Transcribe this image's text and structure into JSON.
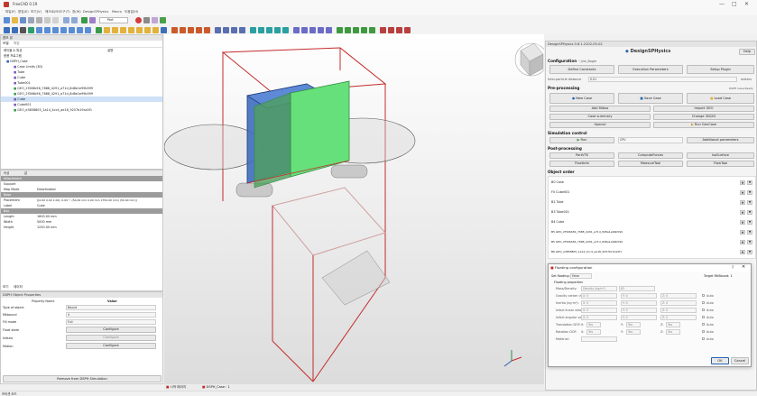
{
  "window": {
    "title": "FreeCAD 0.19",
    "controls": [
      "—",
      "□",
      "✕"
    ]
  },
  "menu": [
    "파일(F)",
    "편집(E)",
    "보기(V)",
    "매크로(M)",
    "도구(T)",
    "창(W)",
    "DesignSPHysics",
    "Macro",
    "도움말(H)"
  ],
  "toolbar": {
    "workbench": "Part"
  },
  "combo": {
    "header": "콤보 뷰",
    "tabs": [
      "모델",
      "작업"
    ],
    "col_labels": "레이블 & 특성",
    "col_value": "설명",
    "doc_label": "응용 프로그램",
    "tree": [
      "DSPH_Case",
      "Case Limits (3D)",
      "Tube",
      "Cube",
      "Tube001",
      "GEO_2f306b56_7688_4291_a71d_8d8e1e99b599",
      "GEO_2f306b56_7688_4291_a71d_8d8e1e99b599",
      "Cube",
      "Cube001",
      "GEO_e3858805_1a14_4cc4_ae18_9257b19ca5f1"
    ]
  },
  "props": {
    "col1": "속성",
    "col2": "값",
    "groups": [
      "Attachment",
      "Base",
      "Box"
    ],
    "rows": [
      {
        "k": "Support",
        "v": ""
      },
      {
        "k": "Map Mode",
        "v": "Deactivated"
      },
      {
        "k": "Placement",
        "v": "[(0.00 0.00 1.00); 0.00 °; (50.00 mm  0.00 mm  1750.00 mm) (50.00 mm)]"
      },
      {
        "k": "Label",
        "v": "Cube"
      },
      {
        "k": "Length",
        "v": "1600.00 mm"
      },
      {
        "k": "Width",
        "v": "5000 mm"
      },
      {
        "k": "Height",
        "v": "1250.00 mm"
      }
    ],
    "tabs": [
      "보기",
      "데이터"
    ]
  },
  "dsph_props": {
    "header": "DSPH Object Properties",
    "col_name": "Property Name",
    "col_value": "Value",
    "rows": [
      {
        "k": "Type of object",
        "v": "Bound"
      },
      {
        "k": "Mkbound",
        "v": "4"
      },
      {
        "k": "Fill mode",
        "v": "Full"
      },
      {
        "k": "Float state",
        "v": "Configure"
      },
      {
        "k": "Initials",
        "v": "Configure"
      },
      {
        "k": "Motion",
        "v": "Configure"
      }
    ],
    "remove_btn": "Remove from DSPH Simulation"
  },
  "viewport_tabs": [
    "시작 페이지",
    "DSPH_Case : 1"
  ],
  "statusbar": "프리셋 모드",
  "right": {
    "header": "DesignSPHysics 0.6.1.2102-05-02",
    "help": "Help",
    "logo": "DesignSPHysics",
    "config_title": "Configuration",
    "config_sub": "~/jrw_Bogie",
    "btn_define": "Define Constants",
    "btn_exec": "Execution Parameters",
    "btn_setup": "Setup Plugin",
    "dp_label": "Inter-particle distance",
    "dp_value": "0.01",
    "dp_unit": "meters",
    "preproc": "Pre-processing",
    "preproc_note": "DSPH Case Ready",
    "new_case": "New Case",
    "save_case": "Save Case",
    "load_case": "Load Case",
    "add_stl": "Add fillbox",
    "import_geo": "Import GEO",
    "case_summary": "Case summary",
    "change_2d": "Change 3D/2D",
    "special": "Special",
    "run_gencase": "Run GenCase",
    "sim_title": "Simulation control",
    "run": "Run",
    "cpu": "CPU",
    "add_params": "Additional parameters",
    "post_title": "Post-processing",
    "part_vtk": "PartVTK",
    "compute_forces": "ComputeForces",
    "iso_surface": "IsoSurface",
    "float_info": "FloatInfo",
    "measure_tool": "MeasureTool",
    "flow_tool": "FlowTool",
    "order_title": "Object order",
    "objects": [
      "B0 Case",
      "F0 Cube001",
      "B2 Tube",
      "B3 Tube001",
      "B4 Cube",
      "B5 GEO_2f306b56_7688_4291_a71d_8d8e1e99b599",
      "B5 GEO_2f306b56_7688_4291_a71d_8d8e1e99b599",
      "B6 GEO_e3858805_1a14_4cc4_ae18_9257b19ca5f1"
    ]
  },
  "dialog": {
    "title": "Floating configuration",
    "set_floating": "Set floating:",
    "false": "False",
    "target": "Target MkBound: 1",
    "group": "Floating properties",
    "rows": [
      "Mass/Density:",
      "Gravity center (m):",
      "Inertia (kg·m²):",
      "Initial linear velocity:",
      "Initial angular velocity:",
      "Translation DOF:",
      "Rotation DOF:",
      "Material:"
    ],
    "mass_type": "Density (kg/m³)",
    "mass_value": "83",
    "x": "X:",
    "y": "Y:",
    "z": "Z:",
    "zero": "0",
    "auto": "Auto",
    "yes": "Yes",
    "ok": "OK",
    "cancel": "Cancel"
  },
  "colors": {
    "accent": "#2563b0",
    "blue_box": "#3f6dbf",
    "green_box": "#66e07a",
    "red_box": "#c42b2b"
  }
}
